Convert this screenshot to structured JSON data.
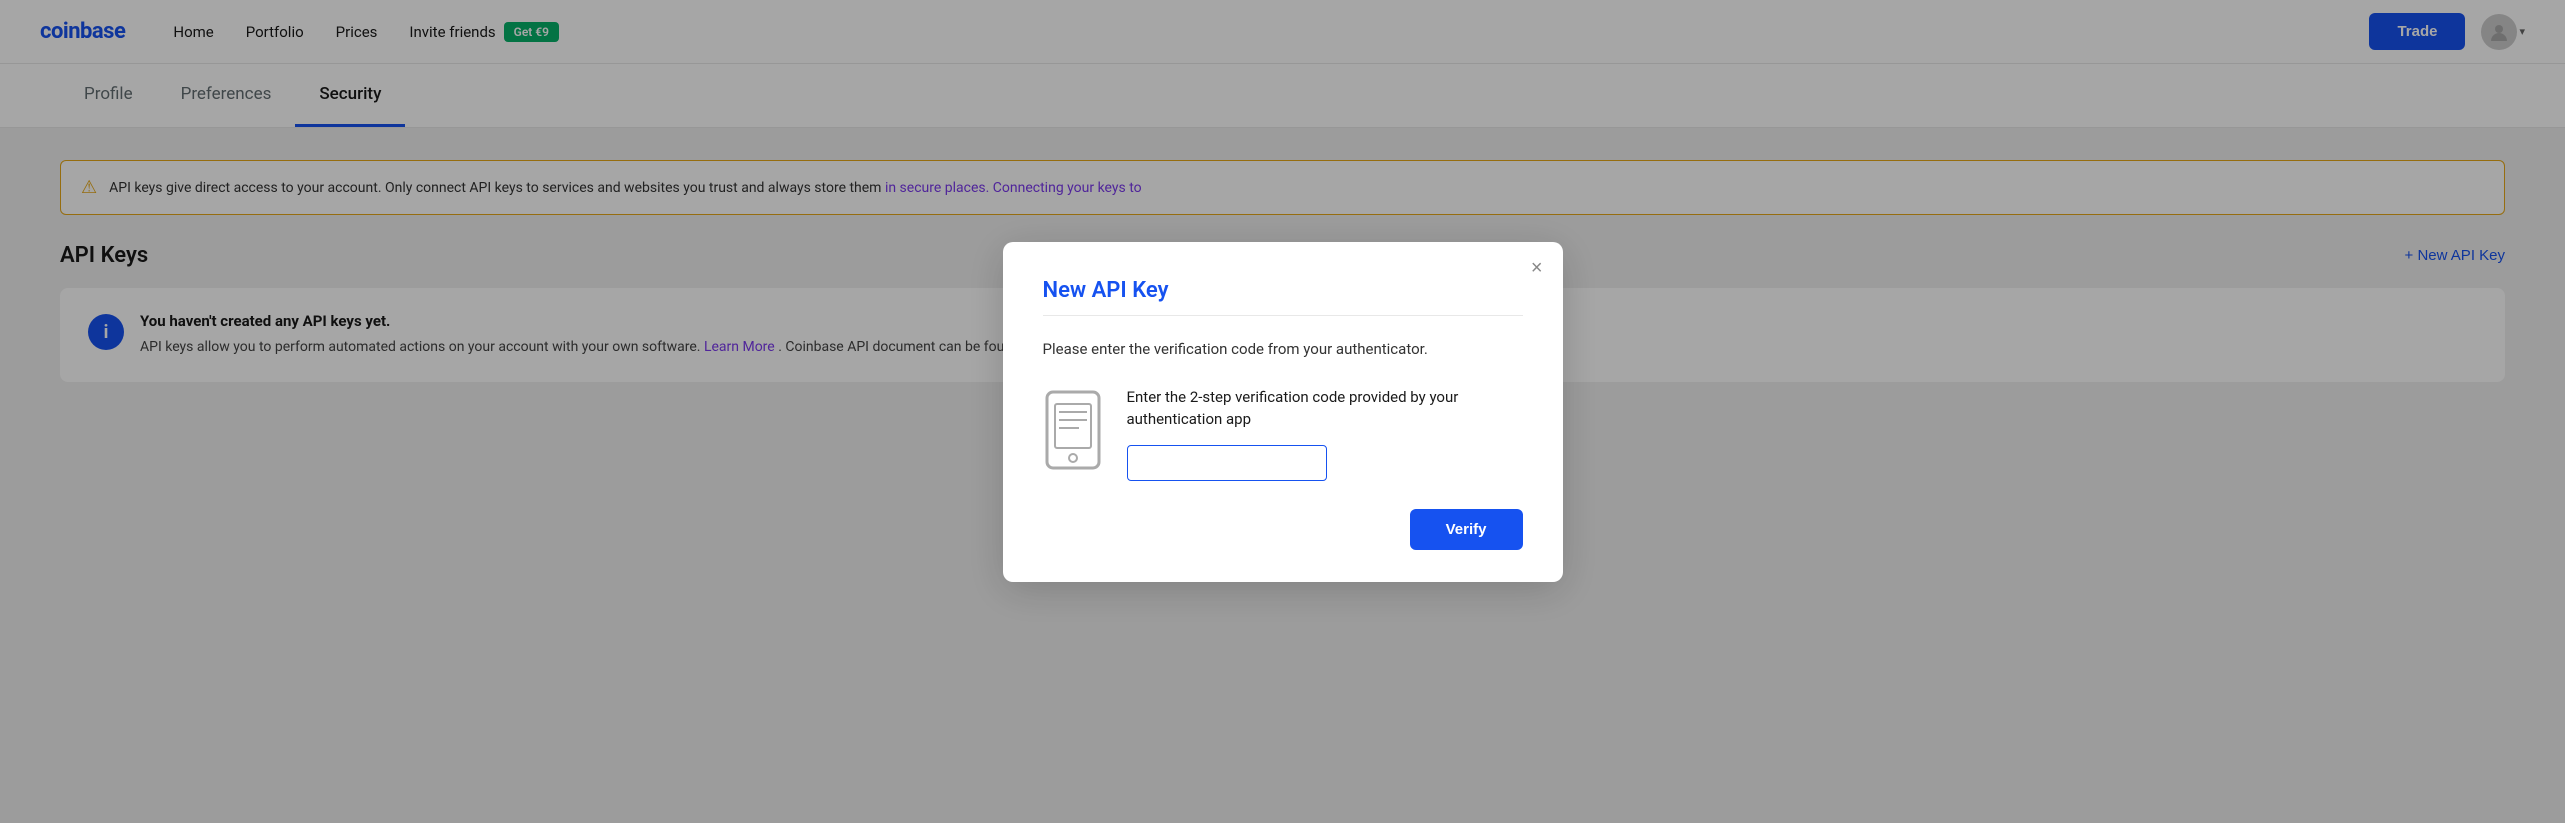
{
  "header": {
    "logo": "coinbase",
    "nav": [
      {
        "label": "Home",
        "id": "home"
      },
      {
        "label": "Portfolio",
        "id": "portfolio"
      },
      {
        "label": "Prices",
        "id": "prices"
      },
      {
        "label": "Invite friends",
        "id": "invite"
      },
      {
        "badge": "Get €9"
      }
    ],
    "trade_label": "Trade",
    "avatar_alt": "User avatar"
  },
  "tabs": [
    {
      "label": "Profile",
      "id": "profile",
      "active": false
    },
    {
      "label": "Preferences",
      "id": "preferences",
      "active": false
    },
    {
      "label": "Security",
      "id": "security",
      "active": true
    }
  ],
  "warning": {
    "text": "API keys give direct access to your account. Only connect API keys to services and websites you trust and always store them",
    "link_text": "in secure places. Connecting your keys to",
    "icon": "⚠"
  },
  "api_section": {
    "title": "API Keys",
    "new_key_label": "+ New API Key"
  },
  "info_box": {
    "heading": "You haven't created any API keys yet.",
    "body": "API keys allow you to perform automated actions on your account with your own software.",
    "link_text": "Learn More",
    "body_suffix": ". Coinbase API document can be found"
  },
  "modal": {
    "title": "New API Key",
    "close_label": "×",
    "subtitle": "Please enter the verification code from your authenticator.",
    "instruction": "Enter the 2-step verification code provided by your authentication app",
    "input_placeholder": "",
    "verify_label": "Verify"
  }
}
